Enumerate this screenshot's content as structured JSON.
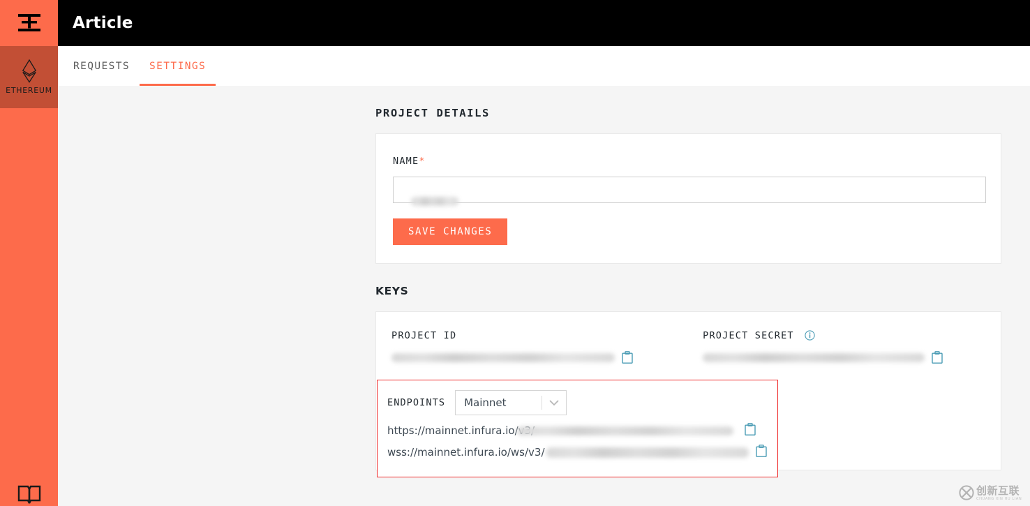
{
  "colors": {
    "brand_orange": "#fd6b4b",
    "sidebar_active": "#c24f35",
    "header_black": "#000000",
    "page_background": "#f5f5f5",
    "card_background": "#ffffff",
    "highlight_border_red": "#ef2b2b",
    "copy_icon_teal": "#4b9cb5",
    "info_icon_teal": "#4b9cb5",
    "text_dark": "#22292f"
  },
  "sidebar": {
    "logo_icon": "infura-logo-icon",
    "network": {
      "icon": "ethereum-diamond-icon",
      "label": "ETHEREUM"
    },
    "bottom_icon": "book-docs-icon"
  },
  "header": {
    "title": "Article"
  },
  "tabs": [
    {
      "label": "REQUESTS",
      "active": false
    },
    {
      "label": "SETTINGS",
      "active": true
    }
  ],
  "project_details": {
    "heading": "PROJECT DETAILS",
    "name_label": "NAME",
    "name_required_marker": "*",
    "name_value": "",
    "name_placeholder": "",
    "name_value_redacted": true,
    "save_button_label": "SAVE CHANGES"
  },
  "keys": {
    "heading": "KEYS",
    "project_id": {
      "label": "PROJECT ID",
      "value_redacted": true,
      "copy_icon": "clipboard-copy-icon"
    },
    "project_secret": {
      "label": "PROJECT SECRET",
      "info_icon": "info-circle-icon",
      "value_redacted": true,
      "copy_icon": "clipboard-copy-icon"
    },
    "endpoints": {
      "label": "ENDPOINTS",
      "selected_network": "Mainnet",
      "network_options": [
        "Mainnet"
      ],
      "dropdown_icon": "chevron-down-icon",
      "items": [
        {
          "url_prefix": "https://mainnet.infura.io/v3/",
          "key_redacted": true,
          "copy_icon": "clipboard-copy-icon"
        },
        {
          "url_prefix": "wss://mainnet.infura.io/ws/v3/",
          "key_redacted": true,
          "copy_icon": "clipboard-copy-icon"
        }
      ]
    }
  },
  "watermark": {
    "text_cn": "创新互联",
    "text_pinyin": "CHUANG XIN HU LIAN",
    "icon": "watermark-x-logo-icon"
  }
}
